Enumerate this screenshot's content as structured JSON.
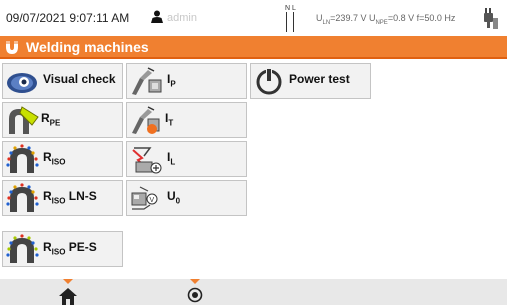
{
  "status": {
    "datetime": "09/07/2021 9:07:11 AM",
    "user": "admin",
    "nl_n": "N",
    "nl_l": "L",
    "u_ln_label": "U",
    "u_ln_sub": "LN",
    "u_ln_value": "=239.7 V",
    "u_npe_label": "U",
    "u_npe_sub": "NPE",
    "u_npe_value": "=0.8 V",
    "freq": "f=50.0 Hz"
  },
  "title": "Welding machines",
  "tiles": {
    "visual_check": "Visual check",
    "ip": {
      "main": "I",
      "sub": "P"
    },
    "power_test": "Power test",
    "rpe": {
      "main": "R",
      "sub": "PE"
    },
    "it": {
      "main": "I",
      "sub": "T"
    },
    "riso": {
      "main": "R",
      "sub": "ISO"
    },
    "il": {
      "main": "I",
      "sub": "L"
    },
    "riso_lns": {
      "main": "R",
      "sub": "ISO",
      "suffix": " LN-S"
    },
    "u0": {
      "main": "U",
      "sub": "0"
    },
    "riso_pes": {
      "main": "R",
      "sub": "ISO",
      "suffix": " PE-S"
    }
  },
  "colors": {
    "accent": "#f08030",
    "tile_bg": "#f2f2f2",
    "bottom_bar": "#e8e8e8"
  },
  "icons": {
    "title": "welding-magnet-icon",
    "visual_check": "eye-icon",
    "power_test": "power-icon",
    "home": "home-icon",
    "settings": "record-icon"
  }
}
